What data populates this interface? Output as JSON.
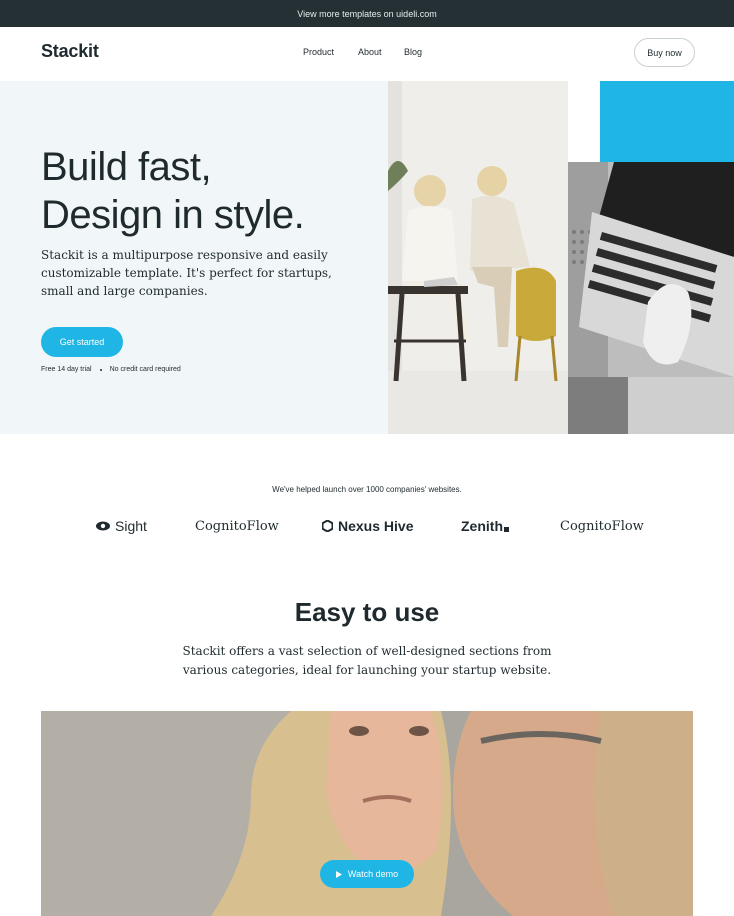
{
  "topbar": {
    "text": "View more templates on uideli.com"
  },
  "nav": {
    "logo": "Stackit",
    "links": [
      "Product",
      "About",
      "Blog"
    ],
    "buy_label": "Buy now"
  },
  "hero": {
    "title_line1": "Build fast,",
    "title_line2": "Design in style.",
    "subtitle": "Stackit is a multipurpose responsive and easily customizable template. It's perfect for startups, small and large companies.",
    "cta_label": "Get started",
    "note_trial": "Free 14 day trial",
    "note_card": "No credit card required"
  },
  "logos": {
    "caption": "We've helped launch over 1000 companies' websites.",
    "items": [
      "Sight",
      "CognitoFlow",
      "Nexus Hive",
      "Zenith",
      "CognitoFlow"
    ]
  },
  "feature": {
    "title": "Easy to use",
    "subtitle": "Stackit offers a vast selection of well-designed sections from various categories, ideal for launching your startup website.",
    "watch_label": "Watch demo"
  },
  "colors": {
    "accent": "#1fb6e6",
    "dark": "#253035",
    "hero_bg": "#f1f7f8"
  }
}
